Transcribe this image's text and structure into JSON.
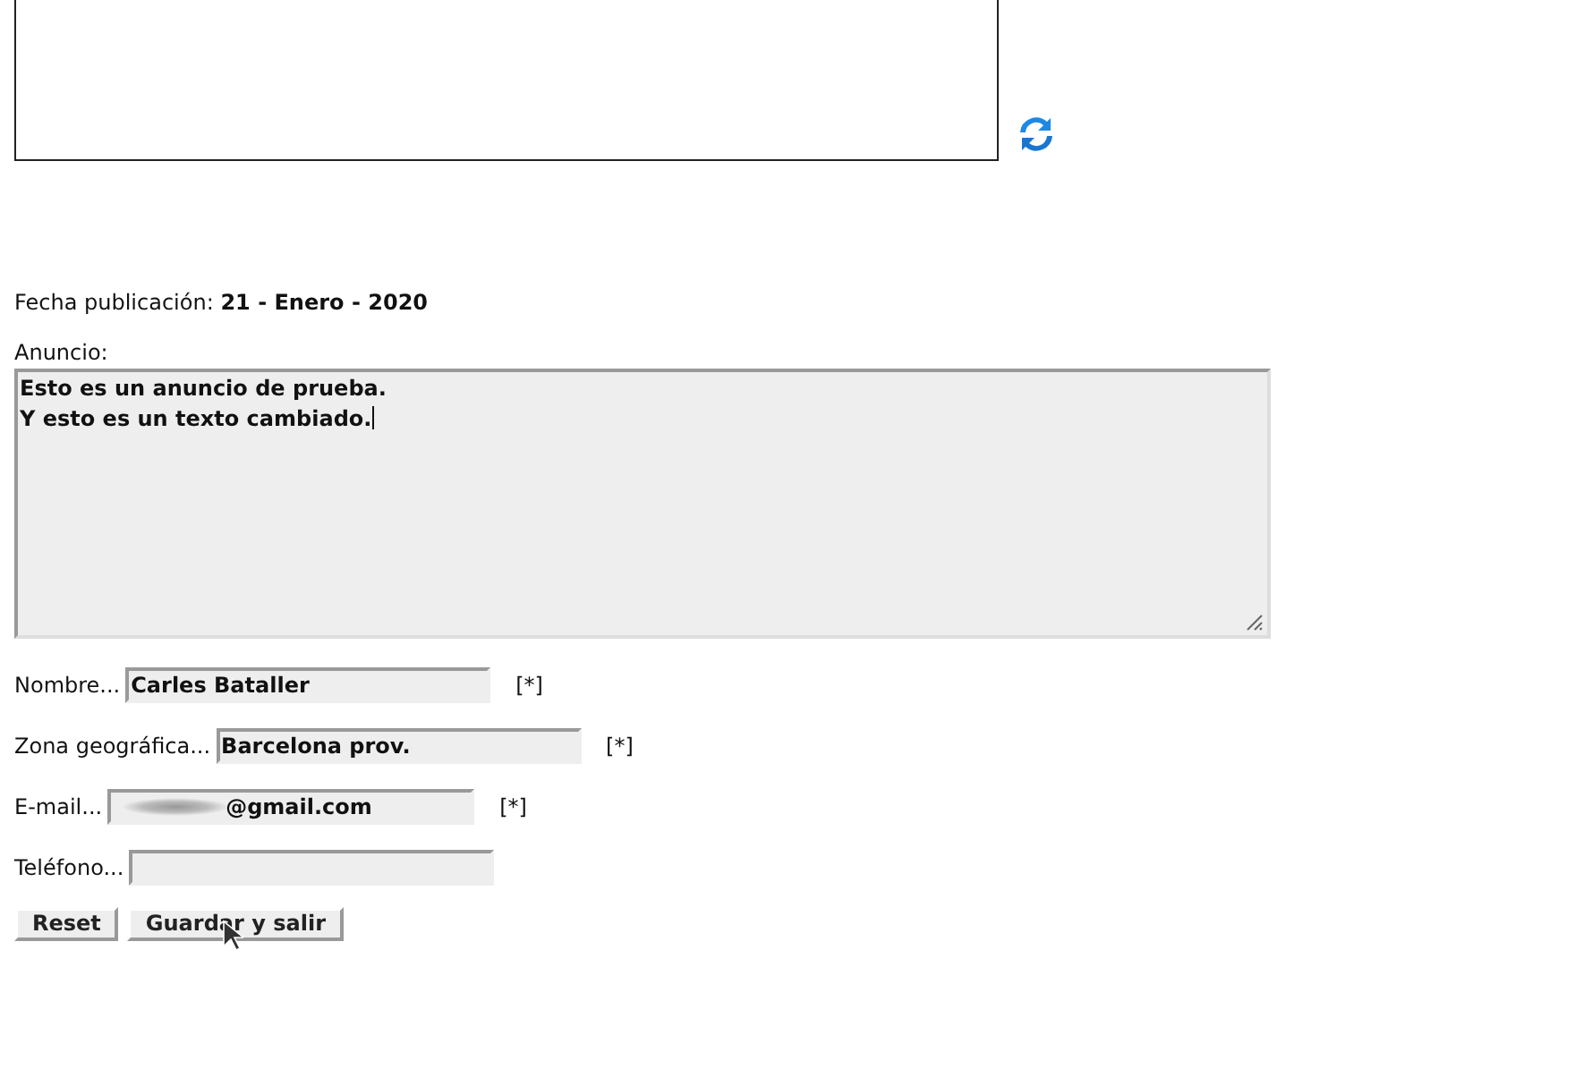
{
  "date": {
    "label": "Fecha publicación:",
    "value": "21 - Enero - 2020"
  },
  "announcement": {
    "label": "Anuncio:",
    "value": "Esto es un anuncio de prueba.\nY esto es un texto cambiado."
  },
  "fields": [
    {
      "label": "Nombre...",
      "value": "Carles Bataller",
      "required_marker": "[*]"
    },
    {
      "label": "Zona geográfica...",
      "value": "Barcelona prov.",
      "required_marker": "[*]"
    },
    {
      "label": "E-mail...",
      "value": "@gmail.com",
      "redacted": true,
      "required_marker": "[*]"
    },
    {
      "label": "Teléfono..."
    }
  ],
  "buttons": [
    "Reset",
    "Guardar y salir"
  ]
}
